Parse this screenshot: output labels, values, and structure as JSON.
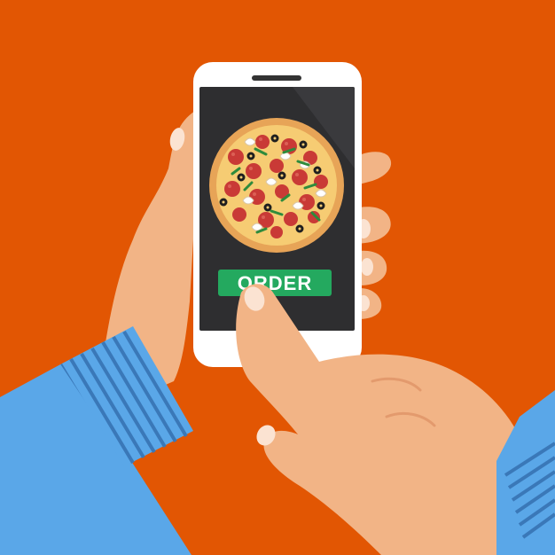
{
  "illustration": {
    "background_color": "#E25603",
    "phone": {
      "body_color": "#FFFFFF",
      "screen_color": "#2E2E30",
      "order_button": {
        "label": "ORDER",
        "color": "#24A95F",
        "text_color": "#FFFFFF"
      }
    },
    "pizza": {
      "crust_color": "#E7A457",
      "cheese_color": "#F6CC73",
      "pepperoni_color": "#C93A36",
      "olive_color": "#1F1F1F",
      "herb_color": "#2E8B3C"
    },
    "hands": {
      "skin_color": "#F2B486",
      "sleeve_color": "#5AA7E8",
      "cuff_stripe_color": "#3A78B8"
    }
  }
}
